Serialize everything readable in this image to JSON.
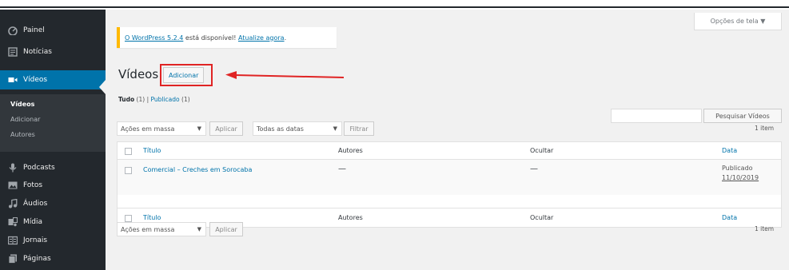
{
  "sidebar": {
    "items": [
      {
        "label": "Painel",
        "icon": "dashboard-icon"
      },
      {
        "label": "Notícias",
        "icon": "posts-icon"
      },
      {
        "label": "Vídeos",
        "icon": "video-icon"
      },
      {
        "label": "Podcasts",
        "icon": "microphone-icon"
      },
      {
        "label": "Fotos",
        "icon": "image-icon"
      },
      {
        "label": "Áudios",
        "icon": "music-icon"
      },
      {
        "label": "Mídia",
        "icon": "media-icon"
      },
      {
        "label": "Jornais",
        "icon": "newspaper-icon"
      },
      {
        "label": "Páginas",
        "icon": "pages-icon"
      }
    ],
    "submenu": [
      "Vídeos",
      "Adicionar",
      "Autores"
    ],
    "active_color": "#0073aa",
    "background_color": "#23282d"
  },
  "screen_options": {
    "label": "Opções de tela ▼"
  },
  "notice": {
    "link1": "O WordPress 5.2.4",
    "text": " está disponível! ",
    "link2": "Atualize agora",
    "end": ".",
    "border_color": "#ffb900"
  },
  "page": {
    "title": "Vídeos",
    "add_new": "Adicionar"
  },
  "filters": {
    "all": "Tudo",
    "all_count": " (1) ",
    "sep": "|",
    "published": "Publicado",
    "published_count": " (1)"
  },
  "search": {
    "button": "Pesquisar Vídeos"
  },
  "bulk_top": {
    "select": "Ações em massa",
    "apply": "Aplicar"
  },
  "date_filter": {
    "select": "Todas as datas",
    "filter": "Filtrar"
  },
  "items_count": "1 item",
  "bulk_bottom": {
    "select": "Ações em massa",
    "apply": "Aplicar"
  },
  "table": {
    "columns": [
      "Título",
      "Autores",
      "Ocultar",
      "Data"
    ],
    "rows": [
      {
        "title": "Comercial – Creches em Sorocaba",
        "authors": "—",
        "hide": "—",
        "date_status": "Publicado",
        "date": "11/10/2019"
      }
    ]
  },
  "annotation": {
    "color": "#e02424"
  }
}
